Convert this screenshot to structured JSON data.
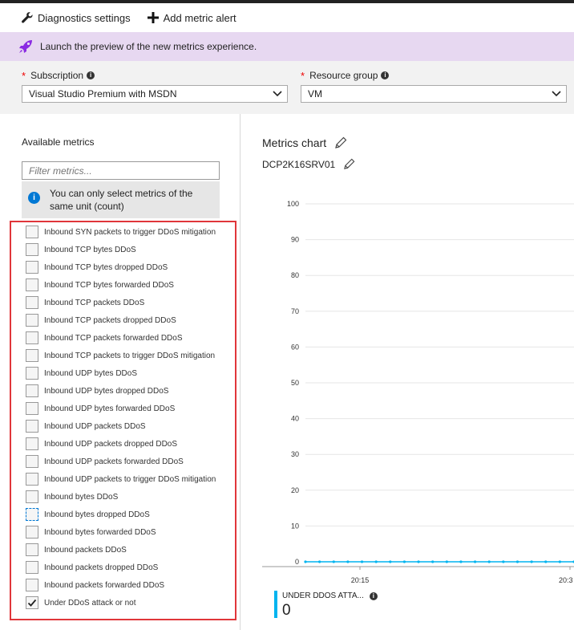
{
  "toolbar": {
    "diagnostics_label": "Diagnostics settings",
    "alert_label": "Add metric alert"
  },
  "banner": {
    "text": "Launch the preview of the new metrics experience."
  },
  "filters": {
    "subscription_label": "Subscription",
    "subscription_value": "Visual Studio Premium with MSDN",
    "resource_group_label": "Resource group",
    "resource_group_value": "VM"
  },
  "left": {
    "title": "Available metrics",
    "filter_placeholder": "Filter metrics...",
    "note": "You can only select metrics of the same unit (count)",
    "metrics": [
      {
        "label": "Inbound SYN packets to trigger DDoS mitigation",
        "checked": false
      },
      {
        "label": "Inbound TCP bytes DDoS",
        "checked": false
      },
      {
        "label": "Inbound TCP bytes dropped DDoS",
        "checked": false
      },
      {
        "label": "Inbound TCP bytes forwarded DDoS",
        "checked": false
      },
      {
        "label": "Inbound TCP packets DDoS",
        "checked": false
      },
      {
        "label": "Inbound TCP packets dropped DDoS",
        "checked": false
      },
      {
        "label": "Inbound TCP packets forwarded DDoS",
        "checked": false
      },
      {
        "label": "Inbound TCP packets to trigger DDoS mitigation",
        "checked": false
      },
      {
        "label": "Inbound UDP bytes DDoS",
        "checked": false
      },
      {
        "label": "Inbound UDP bytes dropped DDoS",
        "checked": false
      },
      {
        "label": "Inbound UDP bytes forwarded DDoS",
        "checked": false
      },
      {
        "label": "Inbound UDP packets DDoS",
        "checked": false
      },
      {
        "label": "Inbound UDP packets dropped DDoS",
        "checked": false
      },
      {
        "label": "Inbound UDP packets forwarded DDoS",
        "checked": false
      },
      {
        "label": "Inbound UDP packets to trigger DDoS mitigation",
        "checked": false
      },
      {
        "label": "Inbound bytes DDoS",
        "checked": false
      },
      {
        "label": "Inbound bytes dropped DDoS",
        "checked": false,
        "focused": true
      },
      {
        "label": "Inbound bytes forwarded DDoS",
        "checked": false
      },
      {
        "label": "Inbound packets DDoS",
        "checked": false
      },
      {
        "label": "Inbound packets dropped DDoS",
        "checked": false
      },
      {
        "label": "Inbound packets forwarded DDoS",
        "checked": false
      },
      {
        "label": "Under DDoS attack or not",
        "checked": true
      }
    ]
  },
  "chart": {
    "title": "Metrics chart",
    "subtitle": "DCP2K16SRV01",
    "legend_name": "UNDER DDOS ATTA...",
    "legend_value": "0",
    "series_color": "#00b4ef"
  },
  "chart_data": {
    "type": "line",
    "ylim": [
      0,
      100
    ],
    "yticks": [
      0,
      10,
      20,
      30,
      40,
      50,
      60,
      70,
      80,
      90,
      100
    ],
    "xticks": [
      "20:15",
      "20:3"
    ],
    "series": [
      {
        "name": "UNDER DDOS ATTA...",
        "values": [
          0,
          0,
          0,
          0,
          0,
          0,
          0,
          0,
          0,
          0,
          0,
          0,
          0,
          0,
          0,
          0,
          0,
          0,
          0,
          0
        ]
      }
    ]
  },
  "colors": {
    "banner_bg": "#e7d8f1",
    "accent": "#0078d4",
    "highlight_border": "#e0363a",
    "required_star": "#e00000"
  }
}
